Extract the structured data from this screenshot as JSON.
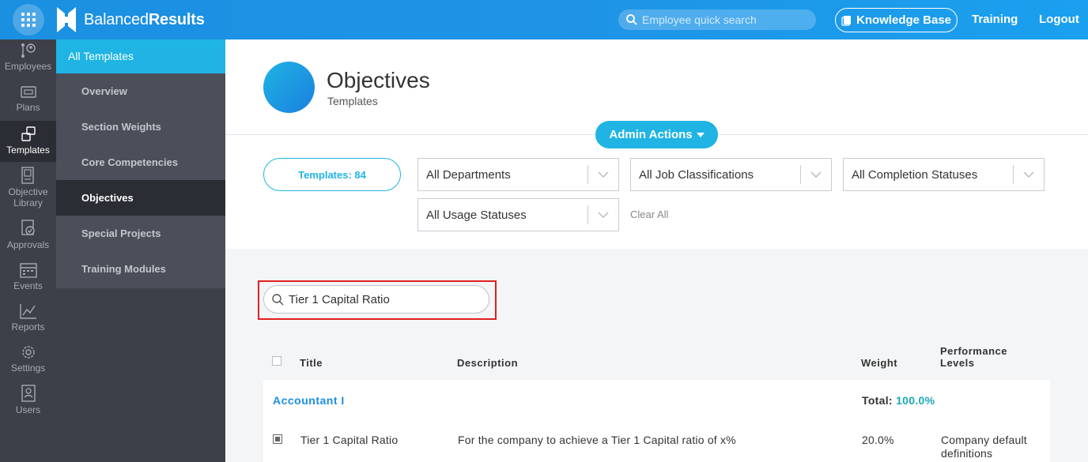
{
  "brand": {
    "name_light": "Balanced",
    "name_bold": "Results"
  },
  "topbar": {
    "search_placeholder": "Employee quick search",
    "knowledge_base": "Knowledge Base",
    "training": "Training",
    "logout": "Logout"
  },
  "iconnav": [
    {
      "label": "Employees",
      "icon": "employees-icon"
    },
    {
      "label": "Plans",
      "icon": "plans-icon"
    },
    {
      "label": "Templates",
      "icon": "templates-icon",
      "active": true
    },
    {
      "label": "Objective Library",
      "icon": "library-icon"
    },
    {
      "label": "Approvals",
      "icon": "approvals-icon"
    },
    {
      "label": "Events",
      "icon": "calendar-icon"
    },
    {
      "label": "Reports",
      "icon": "chart-icon"
    },
    {
      "label": "Settings",
      "icon": "gear-icon"
    },
    {
      "label": "Users",
      "icon": "users-icon"
    }
  ],
  "subnav": {
    "header": "All Templates",
    "items": [
      "Overview",
      "Section Weights",
      "Core Competencies",
      "Objectives",
      "Special Projects",
      "Training Modules"
    ],
    "active": "Objectives"
  },
  "page": {
    "title": "Objectives",
    "subtitle": "Templates"
  },
  "admin_actions": "Admin Actions",
  "filters": {
    "templates_count": "Templates: 84",
    "departments": "All Departments",
    "job_classifications": "All Job Classifications",
    "completion_statuses": "All Completion Statuses",
    "usage_statuses": "All Usage Statuses",
    "clear_all": "Clear All"
  },
  "search": {
    "value": "Tier 1 Capital Ratio"
  },
  "table": {
    "headers": {
      "title": "Title",
      "description": "Description",
      "weight": "Weight",
      "performance_1": "Performance",
      "performance_2": "Levels"
    },
    "group": {
      "title": "Accountant I",
      "total_label": "Total:",
      "total_value": "100.0%"
    },
    "rows": [
      {
        "title": "Tier 1 Capital Ratio",
        "description": "For the company to achieve a Tier 1 Capital ratio of x%",
        "weight": "20.0%",
        "performance_1": "Company default",
        "performance_2": "definitions"
      }
    ]
  },
  "colors": {
    "accent": "#1fb4e4",
    "nav_bg": "#3d4049",
    "highlight": "#e02020"
  }
}
